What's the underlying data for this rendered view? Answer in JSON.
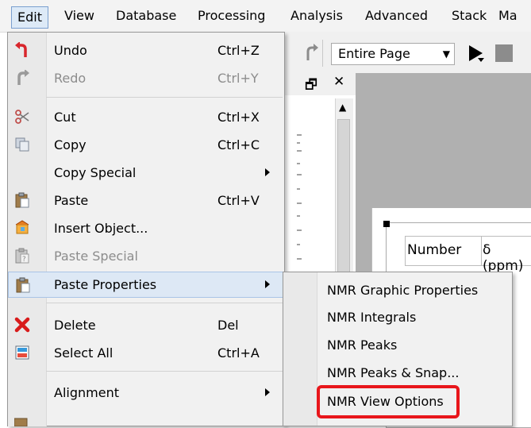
{
  "menubar": {
    "items": [
      {
        "label": "Edit"
      },
      {
        "label": "View"
      },
      {
        "label": "Database"
      },
      {
        "label": "Processing"
      },
      {
        "label": "Analysis"
      },
      {
        "label": "Advanced"
      },
      {
        "label": "Stack"
      },
      {
        "label": "Ma"
      }
    ]
  },
  "toolbar": {
    "page_dropdown_value": "Entire Page"
  },
  "document": {
    "table_headers": [
      "Number",
      "δ (ppm)"
    ]
  },
  "edit_menu": {
    "items": [
      {
        "label": "Undo",
        "shortcut": "Ctrl+Z",
        "enabled": true,
        "icon": "undo-icon"
      },
      {
        "label": "Redo",
        "shortcut": "Ctrl+Y",
        "enabled": false,
        "icon": "redo-icon"
      },
      {
        "label": "Cut",
        "shortcut": "Ctrl+X",
        "enabled": true,
        "icon": "scissors-icon"
      },
      {
        "label": "Copy",
        "shortcut": "Ctrl+C",
        "enabled": true,
        "icon": "copy-icon"
      },
      {
        "label": "Copy Special",
        "shortcut": "",
        "enabled": true,
        "submenu": true
      },
      {
        "label": "Paste",
        "shortcut": "Ctrl+V",
        "enabled": true,
        "icon": "clipboard-icon"
      },
      {
        "label": "Insert Object...",
        "shortcut": "",
        "enabled": true,
        "icon": "insert-object-icon"
      },
      {
        "label": "Paste Special",
        "shortcut": "",
        "enabled": false,
        "icon": "paste-special-icon"
      },
      {
        "label": "Paste Properties",
        "shortcut": "",
        "enabled": true,
        "submenu": true,
        "highlighted": true,
        "icon": "paste-properties-icon"
      },
      {
        "label": "Delete",
        "shortcut": "Del",
        "enabled": true,
        "icon": "delete-x-icon"
      },
      {
        "label": "Select All",
        "shortcut": "Ctrl+A",
        "enabled": true,
        "icon": "select-all-icon"
      },
      {
        "label": "Alignment",
        "shortcut": "",
        "enabled": true,
        "submenu": true
      }
    ]
  },
  "paste_properties_submenu": {
    "items": [
      {
        "label": "NMR Graphic Properties"
      },
      {
        "label": "NMR Integrals"
      },
      {
        "label": "NMR Peaks"
      },
      {
        "label": "NMR Peaks & Snap..."
      },
      {
        "label": "NMR View Options",
        "annotated": true
      }
    ]
  },
  "colors": {
    "menu_background": "#f1f1f1",
    "highlight_background": "#dde8f5",
    "annotation_red": "#e8161b",
    "disabled_text": "#8c8c8c",
    "canvas_gray": "#b0b0b0"
  }
}
